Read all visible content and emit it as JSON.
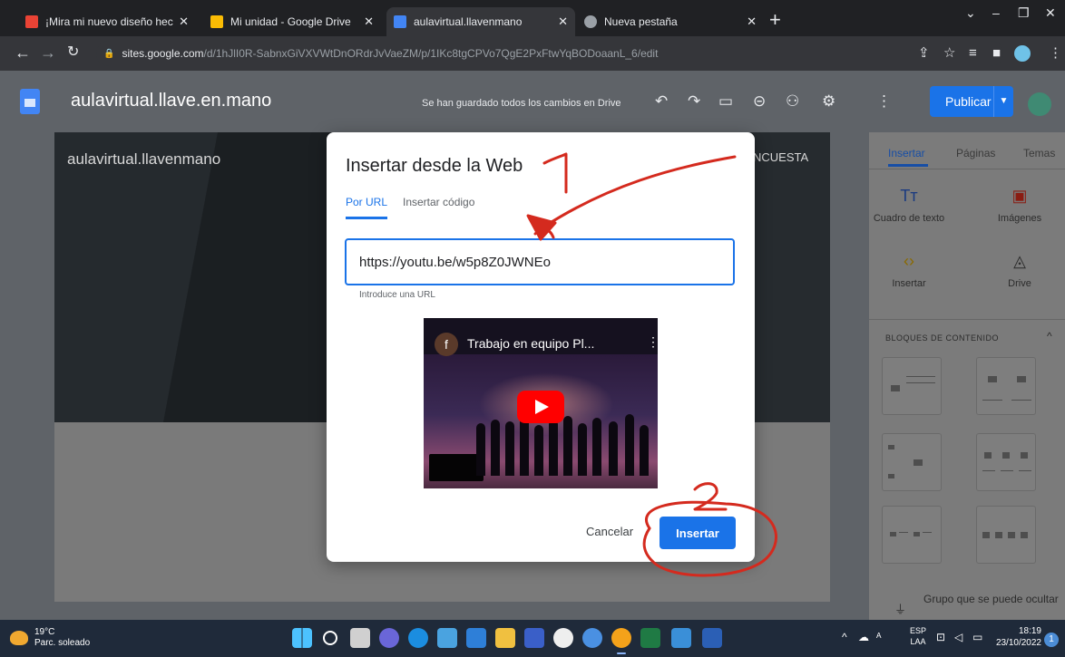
{
  "browser": {
    "tabs": [
      {
        "title": "¡Mira mi nuevo diseño hecho en",
        "favicon_color": "#ea4335"
      },
      {
        "title": "Mi unidad - Google Drive",
        "favicon_color": "#fbbc04"
      },
      {
        "title": "aulavirtual.llavenmano",
        "favicon_color": "#4285f4"
      },
      {
        "title": "Nueva pestaña",
        "favicon_color": "#9aa0a6"
      }
    ],
    "url_host": "sites.google.com",
    "url_path": "/d/1hJlI0R-SabnxGiVXVWtDnORdrJvVaeZM/p/1IKc8tgCPVo7QgE2PxFtwYqBODoaanL_6/edit"
  },
  "sites": {
    "site_title": "aulavirtual.llave.en.mano",
    "save_status": "Se han guardado todos los cambios en Drive",
    "publish_label": "Publicar"
  },
  "canvas": {
    "banner_title": "aulavirtual.llavenmano",
    "banner_menu": "NCUESTA"
  },
  "panel": {
    "tabs": [
      "Insertar",
      "Páginas",
      "Temas"
    ],
    "tools": [
      {
        "label": "Cuadro de texto",
        "icon": "text-box-icon"
      },
      {
        "label": "Imágenes",
        "icon": "image-icon"
      },
      {
        "label": "Insertar",
        "icon": "embed-icon"
      },
      {
        "label": "Drive",
        "icon": "drive-icon"
      }
    ],
    "blocks_heading": "BLOQUES DE CONTENIDO",
    "collapsible_label": "Grupo que se puede ocultar"
  },
  "dialog": {
    "title": "Insertar desde la Web",
    "tab_url": "Por URL",
    "tab_code": "Insertar código",
    "url_value": "https://youtu.be/w5p8Z0JWNEo",
    "url_hint": "Introduce una URL",
    "video_channel_initial": "f",
    "video_title": "Trabajo en equipo Pl...",
    "cancel_label": "Cancelar",
    "insert_label": "Insertar"
  },
  "annotations": {
    "step1": "1",
    "step2": "2",
    "color": "#d42a1e"
  },
  "taskbar": {
    "temperature": "19°C",
    "weather": "Parc. soleado",
    "lang_1": "ESP",
    "lang_2": "LAA",
    "time": "18:19",
    "date": "23/10/2022",
    "notifications": "1"
  }
}
